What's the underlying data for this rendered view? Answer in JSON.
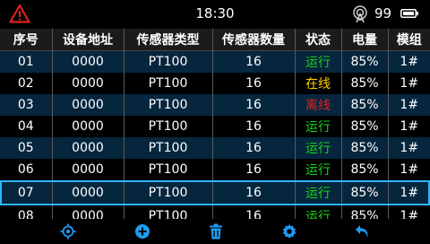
{
  "status": {
    "time": "18:30",
    "signal": "99",
    "warning_color": "#e02020"
  },
  "table": {
    "headers": [
      "序号",
      "设备地址",
      "传感器类型",
      "传感器数量",
      "状态",
      "电量",
      "模组"
    ],
    "status_colors": {
      "运行": "#18d418",
      "在线": "#ffd000",
      "离线": "#e02020"
    },
    "rows": [
      {
        "no": "01",
        "addr": "0000",
        "type": "PT100",
        "count": "16",
        "status": "运行",
        "battery": "85%",
        "module": "1#"
      },
      {
        "no": "02",
        "addr": "0000",
        "type": "PT100",
        "count": "16",
        "status": "在线",
        "battery": "85%",
        "module": "1#"
      },
      {
        "no": "03",
        "addr": "0000",
        "type": "PT100",
        "count": "16",
        "status": "离线",
        "battery": "85%",
        "module": "1#"
      },
      {
        "no": "04",
        "addr": "0000",
        "type": "PT100",
        "count": "16",
        "status": "运行",
        "battery": "85%",
        "module": "1#"
      },
      {
        "no": "05",
        "addr": "0000",
        "type": "PT100",
        "count": "16",
        "status": "运行",
        "battery": "85%",
        "module": "1#"
      },
      {
        "no": "06",
        "addr": "0000",
        "type": "PT100",
        "count": "16",
        "status": "运行",
        "battery": "85%",
        "module": "1#"
      },
      {
        "no": "07",
        "addr": "0000",
        "type": "PT100",
        "count": "16",
        "status": "运行",
        "battery": "85%",
        "module": "1#"
      },
      {
        "no": "08",
        "addr": "0000",
        "type": "PT100",
        "count": "16",
        "status": "运行",
        "battery": "85%",
        "module": "1#"
      }
    ],
    "selected_row": "07"
  },
  "toolbar": {
    "accent": "#1e9bf0",
    "icons": [
      "locate-icon",
      "add-icon",
      "delete-icon",
      "settings-icon",
      "back-icon"
    ]
  }
}
